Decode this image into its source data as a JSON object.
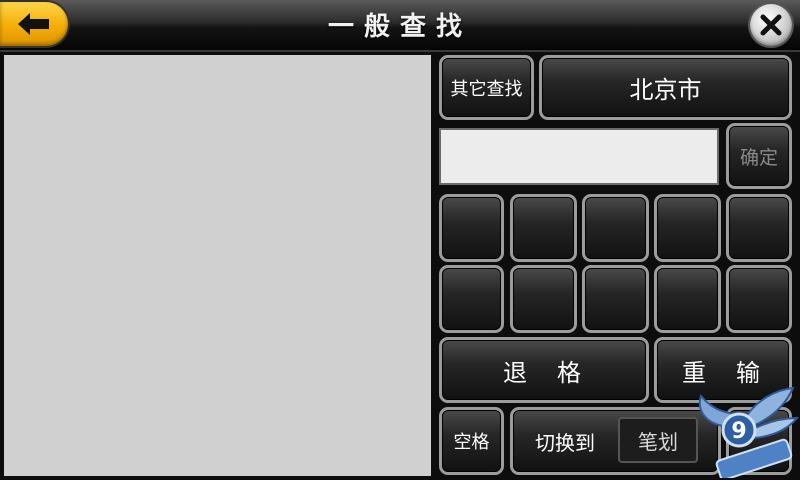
{
  "header": {
    "title": "一般查找"
  },
  "search": {
    "other_search_label": "其它查找",
    "city": "北京市",
    "input_value": "",
    "confirm_label": "确定"
  },
  "keypad": {
    "candidate_keys": [
      "",
      "",
      "",
      "",
      "",
      "",
      "",
      "",
      "",
      ""
    ],
    "backspace_label": [
      "退",
      "格"
    ],
    "reenter_label": [
      "重",
      "输"
    ],
    "space_label": "空格",
    "switch_label": "切换到",
    "switch_mode": "笔划"
  },
  "colors": {
    "back_button": "#f5b00c",
    "panel": "#d0d0d0",
    "background": "#0d0d0d"
  }
}
